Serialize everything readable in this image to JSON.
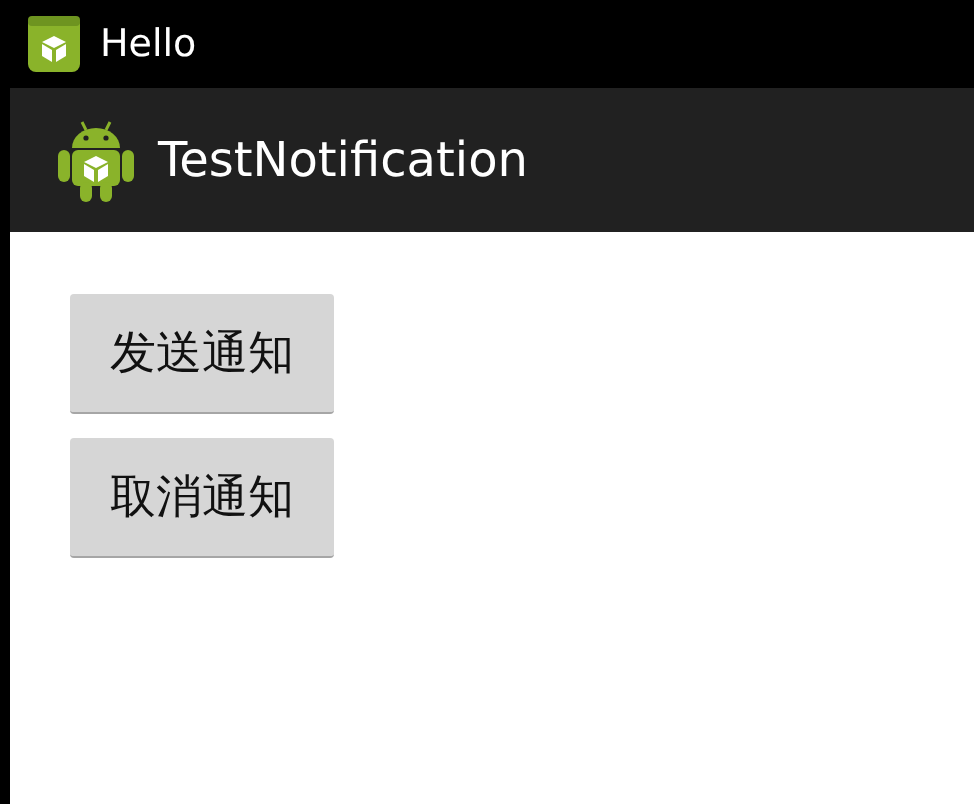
{
  "status_bar": {
    "title": "Hello"
  },
  "action_bar": {
    "title": "TestNotification"
  },
  "buttons": [
    {
      "label": "发送通知"
    },
    {
      "label": "取消通知"
    }
  ]
}
